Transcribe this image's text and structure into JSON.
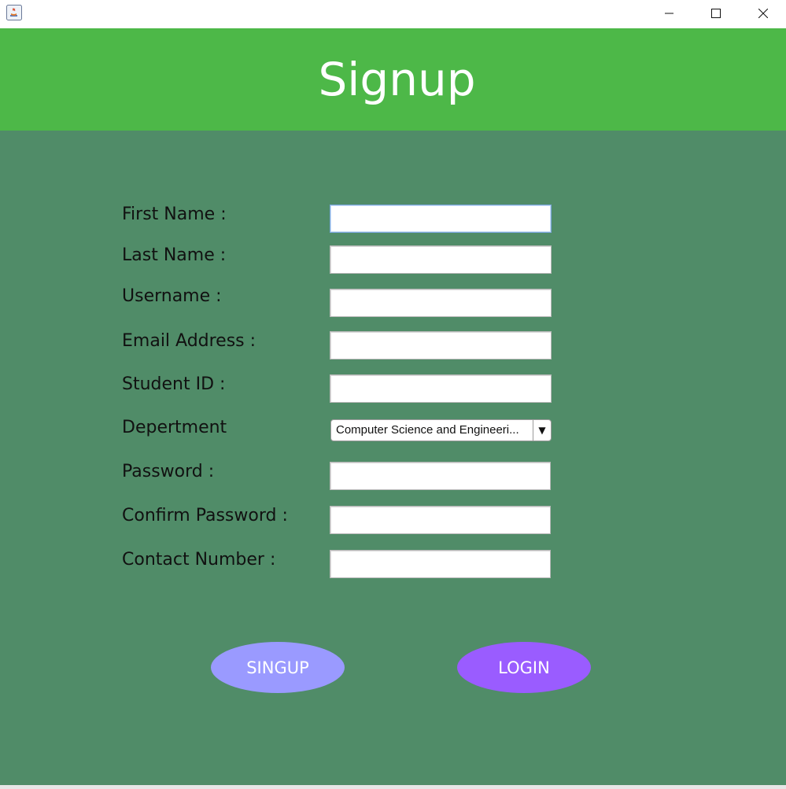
{
  "window": {
    "minimize_icon": "minimize-icon",
    "maximize_icon": "maximize-icon",
    "close_icon": "close-icon",
    "app_icon": "java-app-icon"
  },
  "header": {
    "title": "Signup",
    "color": "#4db848"
  },
  "form": {
    "background": "#508c68",
    "fields": {
      "first_name": {
        "label": "First Name :",
        "value": ""
      },
      "last_name": {
        "label": "Last Name :",
        "value": ""
      },
      "username": {
        "label": "Username :",
        "value": ""
      },
      "email": {
        "label": "Email Address :",
        "value": ""
      },
      "student_id": {
        "label": "Student ID :",
        "value": ""
      },
      "department": {
        "label": "Depertment",
        "selected": "Computer Science and Engineeri..."
      },
      "password": {
        "label": "Password :",
        "value": ""
      },
      "confirm_password": {
        "label": "Confirm Password :",
        "value": ""
      },
      "contact_number": {
        "label": "Contact Number :",
        "value": ""
      }
    }
  },
  "buttons": {
    "signup_label": "SINGUP",
    "signup_color": "#9a9aff",
    "login_label": "LOGIN",
    "login_color": "#9a5cff"
  }
}
